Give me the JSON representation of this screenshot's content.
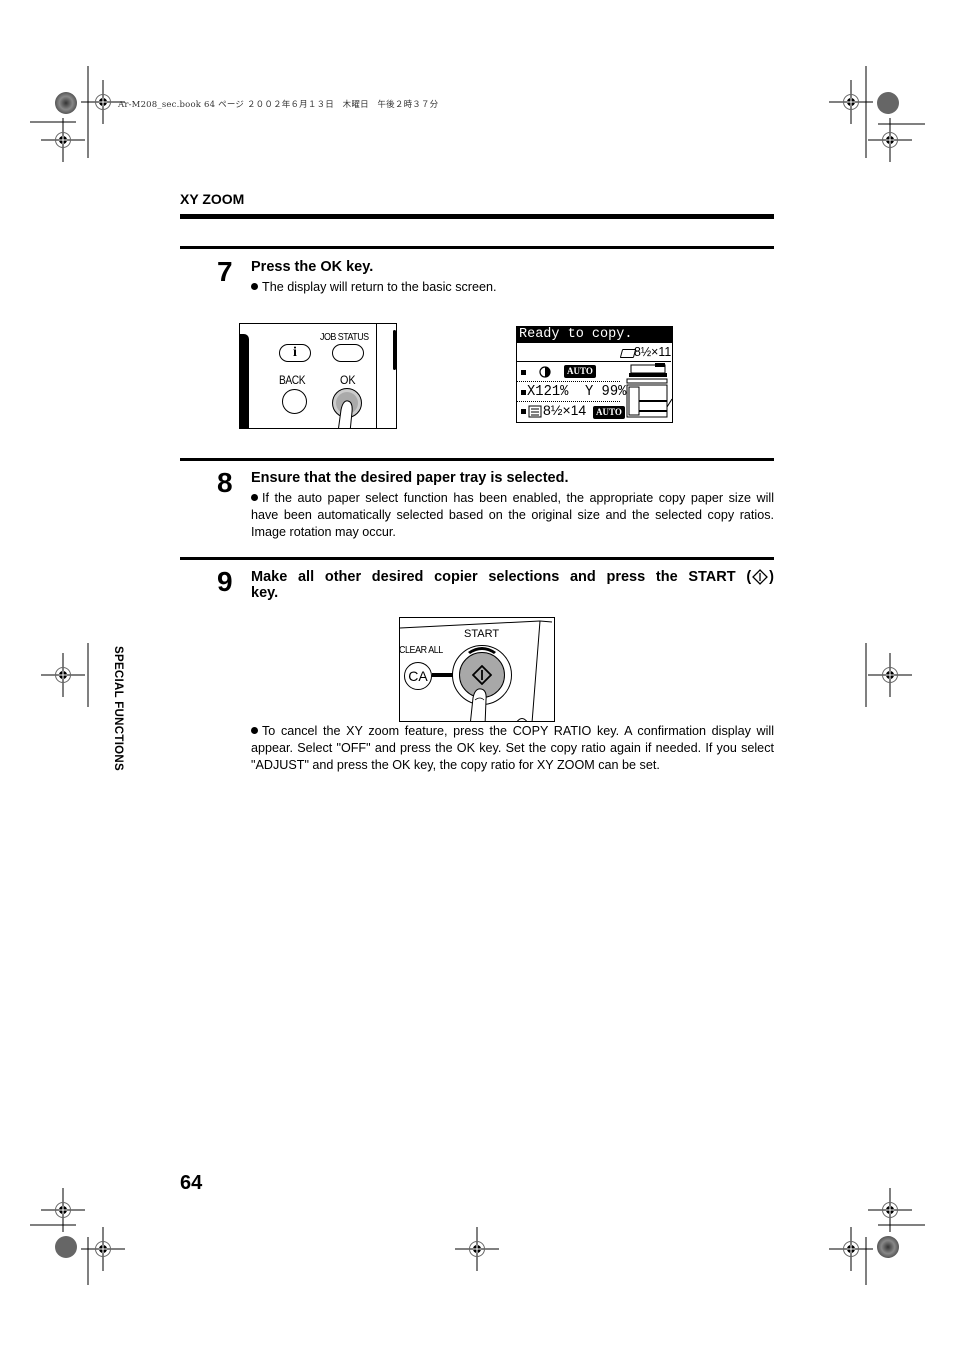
{
  "print_header": {
    "file_info": "Ar-M208_sec.book  64 ページ  ２００２年６月１３日　木曜日　午後２時３７分"
  },
  "section": {
    "title": "XY ZOOM",
    "side_tab": "SPECIAL FUNCTIONS"
  },
  "steps": [
    {
      "number": "7",
      "heading": "Press the OK key.",
      "bullets": [
        "The display will return to the basic screen."
      ]
    },
    {
      "number": "8",
      "heading": "Ensure that the desired paper tray is selected.",
      "bullets": [
        "If the auto paper select function has been enabled, the appropriate copy paper size will have been automatically selected based on the original size and the selected copy ratios. Image rotation may occur."
      ]
    },
    {
      "number": "9",
      "heading_line1": "Make all other desired copier selections and press the START (",
      "heading_close": ")",
      "heading_line2": "key.",
      "bullets": [
        "To cancel the XY zoom feature, press the COPY RATIO key. A confirmation display will appear. Select \"OFF\" and press the OK key. Set the copy ratio again if needed. If you select \"ADJUST\" and press the OK key, the copy ratio for XY ZOOM can be set."
      ]
    }
  ],
  "panel_ok": {
    "info_label": "i",
    "job_status_label": "JOB STATUS",
    "back_label": "BACK",
    "ok_label": "OK"
  },
  "lcd": {
    "status": "Ready to copy.",
    "original_size": "8½×11R",
    "exposure_badge": "AUTO",
    "ratio": "X121%  Y 99%",
    "paper_size": "8½×14",
    "paper_badge": "AUTO"
  },
  "panel_start": {
    "start_label": "START",
    "clear_all_label": "CLEAR ALL",
    "ca_label": "CA"
  },
  "footer": {
    "page_number": "64"
  }
}
